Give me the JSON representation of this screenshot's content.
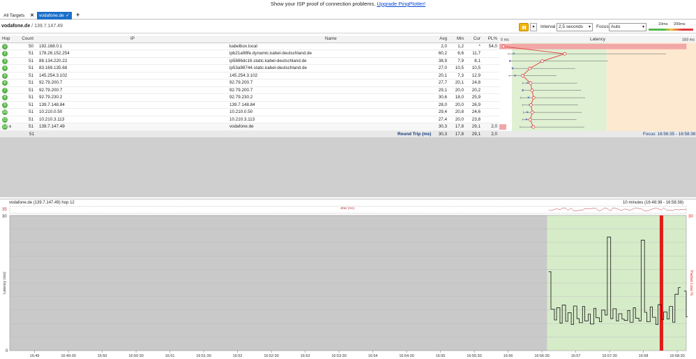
{
  "banner": {
    "text": "Show your ISP proof of connection problems.",
    "link": "Upgrade PingPlotter!"
  },
  "tabs": [
    {
      "label": "All Targets"
    },
    {
      "label": "vodafone.de"
    }
  ],
  "toolbar": {
    "target_host": "vodafone.de",
    "target_ip": " / 139.7.147.49",
    "interval_label": "Interval",
    "interval_value": "2,5 seconds",
    "focus_label": "Focus",
    "focus_value": "Auto",
    "legend_10": "10ms",
    "legend_200": "200ms"
  },
  "table": {
    "headers": {
      "hop": "Hop",
      "count": "Count",
      "ip": "IP",
      "name": "Name",
      "avg": "Avg",
      "min": "Min",
      "cur": "Cur",
      "pl": "PL%",
      "latency": "Latency",
      "lat_min": "0 ms",
      "lat_max": "183 ms"
    },
    "rows": [
      {
        "hop": "1",
        "count": "50",
        "ip": "192.168.0.1",
        "name": "kabelbox.local",
        "avg": "2,0",
        "min": "1,2",
        "cur": "*",
        "pl": "54,0"
      },
      {
        "hop": "2",
        "count": "51",
        "ip": "178.26.152.254",
        "name": "ipb21a98fe.dynamic.kabel-deutschland.de",
        "avg": "60,2",
        "min": "6,6",
        "cur": "11,7",
        "pl": ""
      },
      {
        "hop": "3",
        "count": "51",
        "ip": "88.134.220.22",
        "name": "ip5886dc16.static.kabel-deutschland.de",
        "avg": "38,9",
        "min": "7,9",
        "cur": "8,1",
        "pl": ""
      },
      {
        "hop": "4",
        "count": "51",
        "ip": "83.169.135.68",
        "name": "ip53a98744.static.kabel-deutschland.de",
        "avg": "27,0",
        "min": "10,5",
        "cur": "10,5",
        "pl": ""
      },
      {
        "hop": "5",
        "count": "51",
        "ip": "145.254.3.102",
        "name": "145.254.3.102",
        "avg": "20,1",
        "min": "7,3",
        "cur": "12,9",
        "pl": ""
      },
      {
        "hop": "6",
        "count": "51",
        "ip": "92.79.200.7",
        "name": "92.79.200.7",
        "avg": "27,7",
        "min": "20,1",
        "cur": "24,8",
        "pl": ""
      },
      {
        "hop": "7",
        "count": "51",
        "ip": "92.79.200.7",
        "name": "92.79.200.7",
        "avg": "29,1",
        "min": "20,0",
        "cur": "20,2",
        "pl": ""
      },
      {
        "hop": "8",
        "count": "51",
        "ip": "92.79.230.2",
        "name": "92.79.230.2",
        "avg": "30,6",
        "min": "18,0",
        "cur": "25,9",
        "pl": ""
      },
      {
        "hop": "9",
        "count": "51",
        "ip": "139.7.148.84",
        "name": "139.7.148.84",
        "avg": "28,0",
        "min": "20,0",
        "cur": "26,9",
        "pl": ""
      },
      {
        "hop": "10",
        "count": "51",
        "ip": "10.210.0.50",
        "name": "10.210.0.50",
        "avg": "29,4",
        "min": "20,8",
        "cur": "24,6",
        "pl": ""
      },
      {
        "hop": "11",
        "count": "51",
        "ip": "10.210.3.113",
        "name": "10.210.3.113",
        "avg": "27,4",
        "min": "20,0",
        "cur": "23,8",
        "pl": ""
      },
      {
        "hop": "12",
        "count": "51",
        "ip": "139.7.147.49",
        "name": "vodafone.de",
        "avg": "30,3",
        "min": "17,8",
        "cur": "29,1",
        "pl": "2,0"
      }
    ],
    "summary": {
      "count": "51",
      "label": "Round Trip (ms)",
      "avg": "30,3",
      "min": "17,8",
      "cur": "29,1",
      "pl": "2,0",
      "focus": "Focus: 16:56:35 - 16:58:38"
    }
  },
  "latency_scale_max": 183,
  "graph": {
    "title": "vodafone.de (139.7.147.49) hop 12",
    "range": "10 minutes (16:48:38 - 16:58:38)",
    "jitter_label": "Jitter (ms)",
    "jitter_max": "35",
    "y_left_max": "30",
    "y_left_min": "0",
    "y_right_max": "30",
    "ylabel_left": "Latency (ms)",
    "ylabel_right": "Packet Loss %",
    "x_ticks": [
      "16:49",
      "16:49:30",
      "16:50",
      "16:50:30",
      "16:51",
      "16:51:30",
      "16:52",
      "16:52:30",
      "16:53",
      "16:53:30",
      "16:54",
      "16:54:30",
      "16:55",
      "16:55:30",
      "16:56",
      "16:56:30",
      "16:57",
      "16:57:30",
      "16:58",
      "16:58:30"
    ],
    "colors": {
      "focus_bg": "#d6ecc9",
      "nodata_bg": "#c9c9c9",
      "loss": "#e41b17",
      "line": "#111111",
      "jitter": "#b5343b"
    }
  },
  "chart_data": {
    "type": "line",
    "title": "",
    "xlabel": "",
    "ylabel": "Latency (ms)",
    "x": [
      "16:56:36",
      "16:56:38",
      "16:56:41",
      "16:56:43",
      "16:56:46",
      "16:56:48",
      "16:56:51",
      "16:56:53",
      "16:56:56",
      "16:56:58",
      "16:57:01",
      "16:57:03",
      "16:57:06",
      "16:57:08",
      "16:57:11",
      "16:57:13",
      "16:57:16",
      "16:57:18",
      "16:57:21",
      "16:57:23",
      "16:57:26",
      "16:57:28",
      "16:57:31",
      "16:57:33",
      "16:57:36",
      "16:57:38",
      "16:57:41",
      "16:57:43",
      "16:57:46",
      "16:57:48",
      "16:57:51",
      "16:57:53",
      "16:57:56",
      "16:57:58",
      "16:58:01",
      "16:58:03",
      "16:58:06",
      "16:58:08",
      "16:58:11",
      "16:58:13",
      "16:58:16",
      "16:58:18",
      "16:58:21",
      "16:58:23",
      "16:58:26",
      "16:58:28",
      "16:58:31",
      "16:58:33",
      "16:58:36",
      "16:58:38"
    ],
    "series": [
      {
        "values": [
          17.5,
          9.2,
          6.8,
          9.5,
          6.1,
          10.1,
          6.5,
          8.4,
          5.8,
          9.9,
          7.1,
          6.2,
          9.8,
          6.6,
          8.1,
          5.9,
          9.4,
          7.3,
          6.4,
          9.0,
          7.9,
          25.2,
          7.1,
          9.3,
          6.6,
          8.2,
          7.0,
          6.7,
          8.9,
          6.3,
          9.5,
          7.2,
          6.6,
          24.5,
          8.5,
          6.4,
          9.7,
          7.4,
          5.8,
          10.2,
          6.9,
          8.6,
          7.0,
          9.8,
          6.3,
          12.5,
          14.0,
          null,
          13.2,
          7.5
        ]
      }
    ],
    "loss_x": [
      "16:58:16"
    ],
    "ylim": [
      0,
      30
    ]
  }
}
